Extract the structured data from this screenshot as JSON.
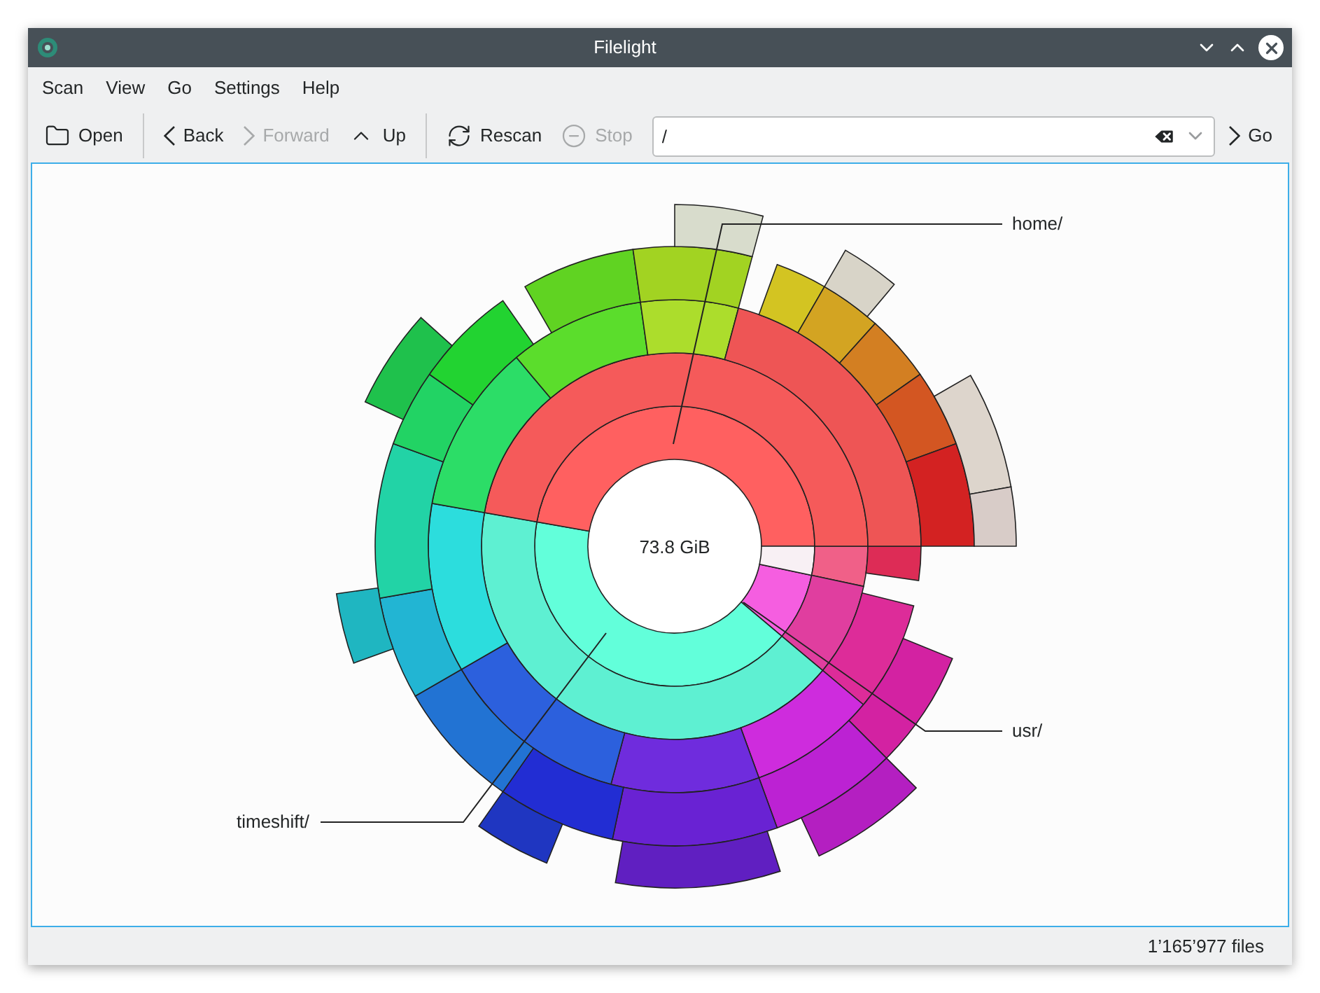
{
  "window": {
    "title": "Filelight"
  },
  "menu": [
    "Scan",
    "View",
    "Go",
    "Settings",
    "Help"
  ],
  "toolbar": [
    {
      "kind": "button",
      "label": "Open",
      "disabled": false
    },
    {
      "kind": "separator"
    },
    {
      "kind": "button",
      "label": "Back",
      "disabled": false
    },
    {
      "kind": "button",
      "label": "Forward",
      "disabled": true
    },
    {
      "kind": "button",
      "label": "Up",
      "disabled": false
    },
    {
      "kind": "separator"
    },
    {
      "kind": "button",
      "label": "Rescan",
      "disabled": false
    },
    {
      "kind": "button",
      "label": "Stop",
      "disabled": true
    }
  ],
  "path_field": {
    "value": "/"
  },
  "go_button": {
    "label": "Go"
  },
  "chart": {
    "center_label": "73.8 GiB",
    "callouts": [
      {
        "label": "home/"
      },
      {
        "label": "usr/"
      },
      {
        "label": "timeshift/"
      }
    ]
  },
  "status_bar": {
    "text": "1’165’977 files"
  }
}
